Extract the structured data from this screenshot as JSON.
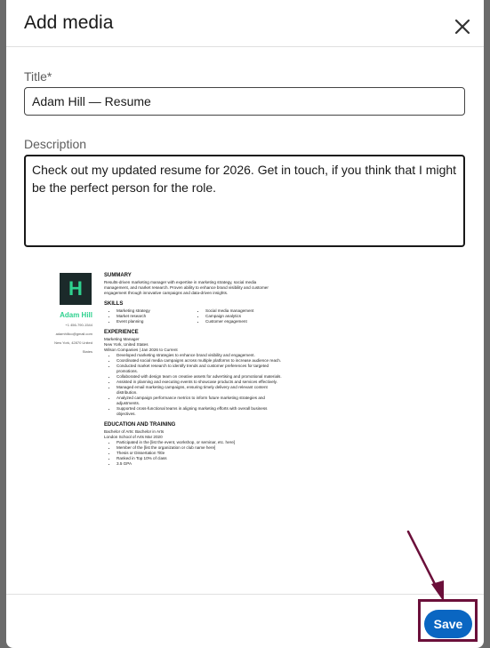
{
  "dialog": {
    "title": "Add media"
  },
  "form": {
    "title_label": "Title*",
    "title_value": "Adam Hill — Resume",
    "description_label": "Description",
    "description_value": "Check out my updated resume for 2026. Get in touch, if you think that I might be the perfect person for the role."
  },
  "resume": {
    "logo_letter": "H",
    "name": "Adam Hill",
    "contact": [
      "+1 456-790-1544",
      "adamhillco@gmail.com",
      "New York, 42870 United",
      "States"
    ],
    "summary_heading": "SUMMARY",
    "summary_text": "Results-driven marketing manager with expertise in marketing strategy, social media management, and market research. Proven ability to enhance brand visibility and customer engagement through innovative campaigns and data-driven insights.",
    "skills_heading": "SKILLS",
    "skills_left": [
      "Marketing strategy",
      "Market research",
      "Event planning"
    ],
    "skills_right": [
      "Social media management",
      "Campaign analytics",
      "Customer engagement"
    ],
    "experience_heading": "EXPERIENCE",
    "job_title": "Marketing Manager",
    "job_location": "New York, United States",
    "job_company": "Wilson Companies | Jan 2026 to Current",
    "job_bullets": [
      "Developed marketing strategies to enhance brand visibility and engagement.",
      "Coordinated social media campaigns across multiple platforms to increase audience reach.",
      "Conducted market research to identify trends and customer preferences for targeted promotions.",
      "Collaborated with design team on creative assets for advertising and promotional materials.",
      "Assisted in planning and executing events to showcase products and services effectively.",
      "Managed email marketing campaigns, ensuring timely delivery and relevant content distribution.",
      "Analyzed campaign performance metrics to inform future marketing strategies and adjustments.",
      "Supported cross-functional teams in aligning marketing efforts with overall business objectives."
    ],
    "education_heading": "EDUCATION AND TRAINING",
    "edu_degree": "Bachelor of Arts: Bachelor in Arts",
    "edu_school": "London School of Arts Mar 2020",
    "edu_bullets": [
      "Participated in the [list the event, workshop, or seminar, etc. here]",
      "Member of the [list the organization or club name here]",
      "Thesis or Dissertation Title",
      "Ranked in Top 10% of class",
      "3.5 GPA"
    ]
  },
  "footer": {
    "save_label": "Save"
  },
  "icons": {
    "close": "close-icon"
  },
  "colors": {
    "primary": "#0a66c2",
    "highlight": "#6b0f3a",
    "resume_accent": "#2fd18f"
  }
}
